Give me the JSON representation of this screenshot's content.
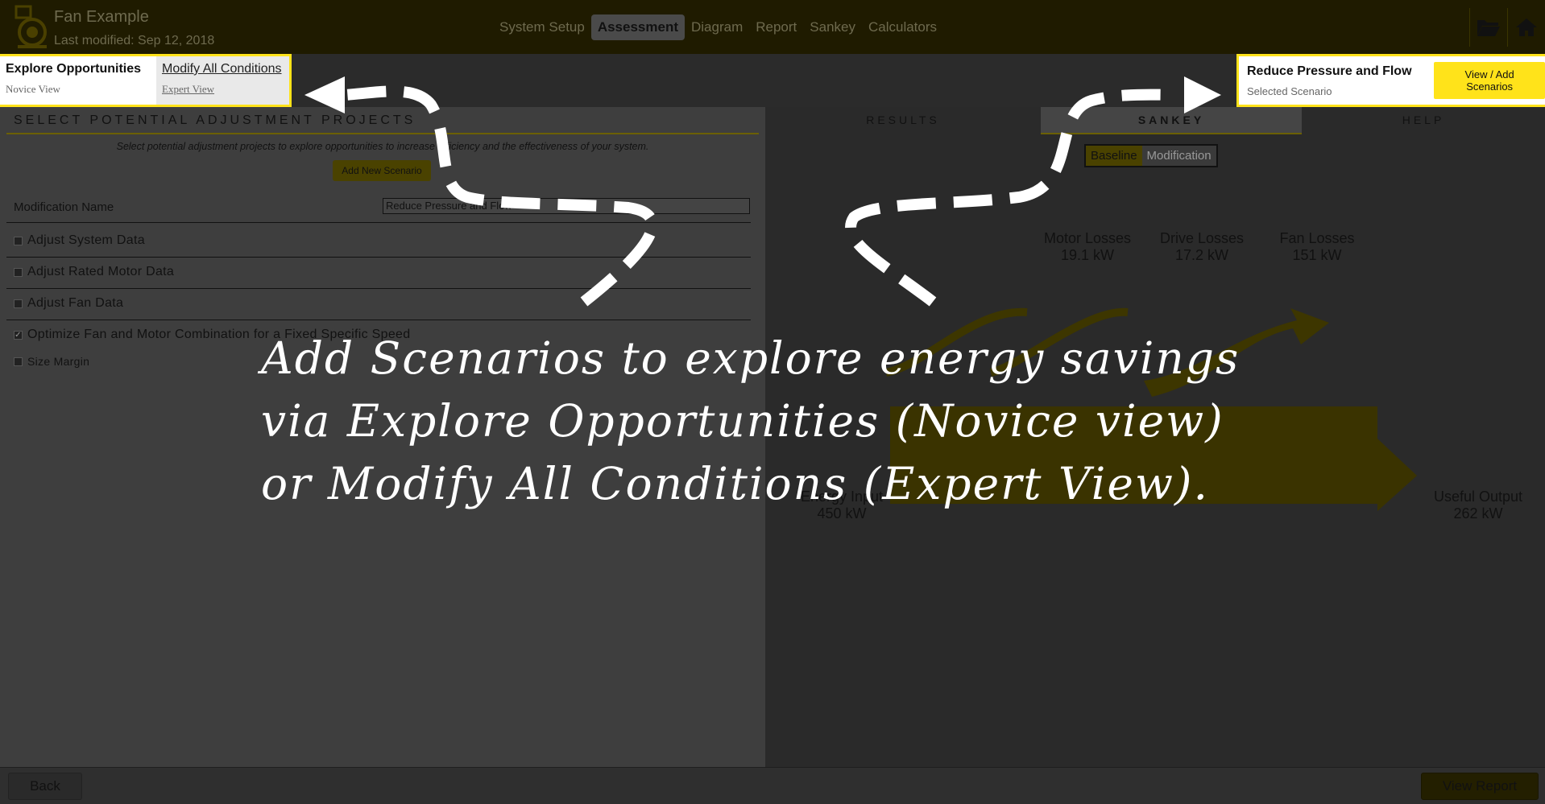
{
  "app": {
    "title": "Fan Example",
    "modified": "Last modified: Sep 12, 2018"
  },
  "nav": [
    "System Setup",
    "Assessment",
    "Diagram",
    "Report",
    "Sankey",
    "Calculators"
  ],
  "modes": {
    "novice_title": "Explore Opportunities",
    "novice_sub": "Novice View",
    "expert_title": "Modify All Conditions",
    "expert_sub": "Expert View"
  },
  "scenario": {
    "title": "Reduce Pressure and Flow",
    "sub": "Selected Scenario",
    "button": "View / Add Scenarios"
  },
  "left": {
    "heading": "SELECT POTENTIAL ADJUSTMENT PROJECTS",
    "description": "Select potential adjustment projects to explore opportunities to increase efficiency and the effectiveness of your system.",
    "add_button": "Add New Scenario",
    "mod_label": "Modification Name",
    "mod_value": "Reduce Pressure and Flow",
    "options": [
      {
        "label": "Adjust System Data",
        "checked": false
      },
      {
        "label": "Adjust Rated Motor Data",
        "checked": false
      },
      {
        "label": "Adjust Fan Data",
        "checked": false
      },
      {
        "label": "Optimize Fan and Motor Combination for a Fixed Specific Speed",
        "checked": true
      },
      {
        "label": "Size Margin",
        "checked": false
      }
    ]
  },
  "right": {
    "tabs": [
      "RESULTS",
      "SANKEY",
      "HELP"
    ],
    "toggle": [
      "Baseline",
      "Modification"
    ],
    "losses": [
      {
        "label": "Motor Losses",
        "value": "19.1 kW"
      },
      {
        "label": "Drive Losses",
        "value": "17.2 kW"
      },
      {
        "label": "Fan Losses",
        "value": "151 kW"
      }
    ],
    "energy_input": {
      "label": "Energy Input",
      "value": "450 kW"
    },
    "useful_output": {
      "label": "Useful Output",
      "value": "262 kW"
    }
  },
  "bottom": {
    "back": "Back",
    "report": "View Report"
  },
  "callout": [
    "Add Scenarios to explore energy savings",
    "via Explore Opportunities (Novice view)",
    "or Modify All Conditions (Expert View)."
  ],
  "colors": {
    "highlight": "#ffe31a",
    "dim_brand": "#4a4200"
  }
}
